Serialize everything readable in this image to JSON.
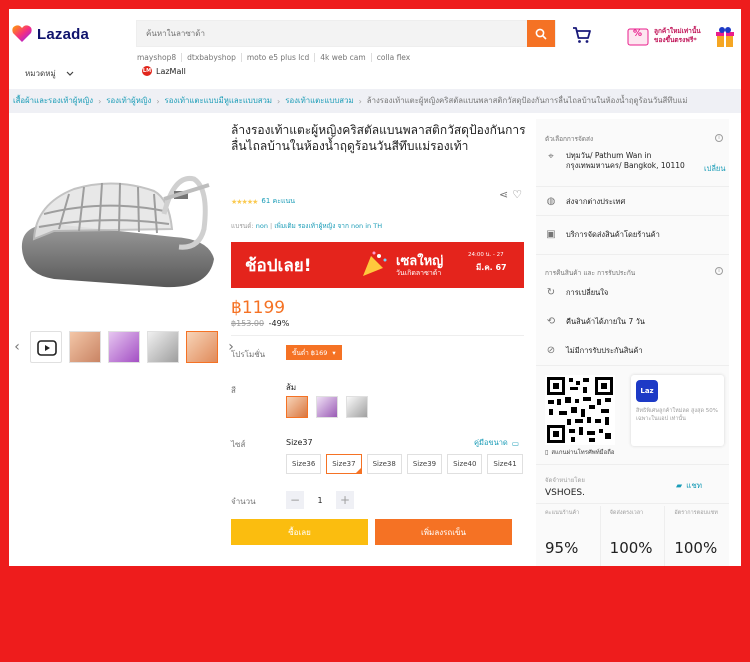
{
  "header": {
    "logo_text": "Lazada",
    "search_placeholder": "ค้นหาในลาซาด้า",
    "suggestions": [
      "mayshop8",
      "dtxbabyshop",
      "moto e5 plus lcd",
      "4k web cam",
      "colla flex"
    ],
    "promo_text_1": "ลูกค้าใหม่เท่านั้น",
    "promo_text_2": "ของขึ้นตรงฟรี*",
    "promo_badge": "%",
    "categories_label": "หมวดหมู่",
    "lazmall_label": "LazMall",
    "lazmall_badge": "LM"
  },
  "breadcrumb": {
    "items": [
      "เสื้อผ้าและรองเท้าผู้หญิง",
      "รองเท้าผู้หญิง",
      "รองเท้าแตะแบบมีหูและแบบสวม",
      "รองเท้าแตะแบบสวม"
    ],
    "current": "ล้างรองเท้าแตะผู้หญิงคริสตัลแบนพลาสติกวัสดุป้องกันการลื่นไถลบ้านในห้องน้ำฤดูร้อนวันสีทึบแม่"
  },
  "product": {
    "title": "ล้างรองเท้าแตะผู้หญิงคริสตัลแบนพลาสติกวัสดุป้องกันการลื่นไถลบ้านในห้องน้ำฤดูร้อนวันสีทึบแม่รองเท้า",
    "rating_stars": "★★★★★",
    "rating_value": 4.5,
    "rating_count": "61 คะแนน",
    "brand_label": "แบรนด์:",
    "brand": "non",
    "brand_more": "เพิ่มเติม รองเท้าผู้หญิง จาก non in TH",
    "banner_left": "ช้อปเลย!",
    "banner_right_1": "เซลใหญ่",
    "banner_right_2": "วันเกิดลาซาด้า",
    "banner_date_1": "24:00 น. - 27",
    "banner_date_2": "มี.ค. 67",
    "price": "฿1199",
    "old_price": "฿153.00",
    "discount": "-49%",
    "promo_label": "โปรโมชั่น",
    "promo_tag": "ขั้นต่ำ ฿169",
    "color_label": "สี",
    "color_value": "ส้ม",
    "size_label": "ไซส์",
    "size_value": "Size37",
    "size_guide": "คู่มือขนาด",
    "sizes": [
      "Size36",
      "Size37",
      "Size38",
      "Size39",
      "Size40",
      "Size41"
    ],
    "qty_label": "จำนวน",
    "qty_minus": "−",
    "qty_value": "1",
    "qty_plus": "+",
    "buy_now": "ซื้อเลย",
    "add_to_cart": "เพิ่มลงรถเข็น"
  },
  "side": {
    "delivery_title": "ตัวเลือกการจัดส่ง",
    "info_glyph": "i",
    "address": "ปทุมวัน/ Pathum Wan in กรุงเทพมหานคร/ Bangkok, 10110",
    "change": "เปลี่ยน",
    "ship_overseas": "ส่งจากต่างประเทศ",
    "delivery_service": "บริการจัดส่งสินค้าโดยร้านค้า",
    "return_title": "การคืนสินค้า และ การรับประกัน",
    "return_1": "การเปลี่ยนใจ",
    "return_2": "คืนสินค้าได้ภายใน 7 วัน",
    "return_3": "ไม่มีการรับประกันสินค้า",
    "app_icon": "Laz",
    "qr_promo": "สิทธิพิเศษลูกค้าใหม่ลด สูงสุด 50% เฉพาะในแอป เท่านั้น",
    "scan_text": "สแกนผ่านโทรศัพท์มือถือ",
    "seller_label": "จัดจำหน่ายโดย",
    "seller_name": "VSHOES.",
    "chat": "แชท",
    "stats": [
      {
        "label": "คะแนนร้านค้า",
        "value": "95%"
      },
      {
        "label": "จัดส่งตรงเวลา",
        "value": "100%"
      },
      {
        "label": "อัตราการตอบแชท",
        "value": "100%"
      }
    ]
  },
  "colors": {
    "accent": "#f57224",
    "buy": "#fbbd0f",
    "link": "#1a9cb7",
    "brand_red": "#ee1c1c"
  }
}
